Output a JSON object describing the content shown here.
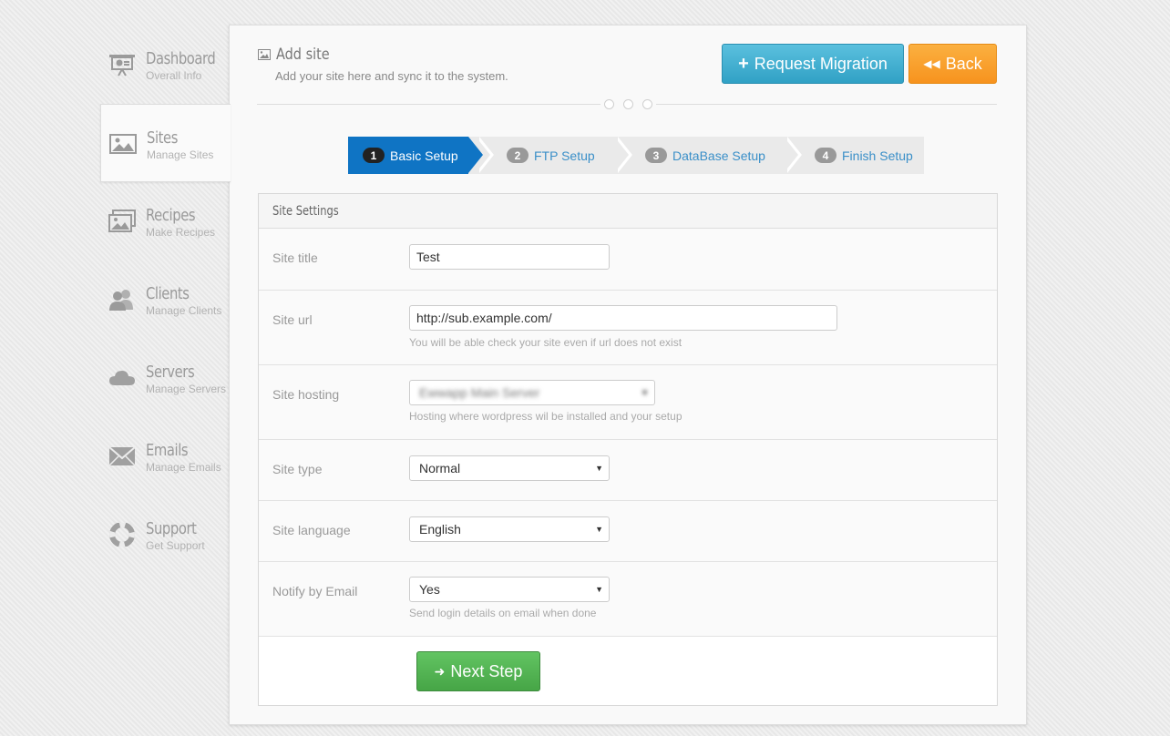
{
  "sidebar": {
    "items": [
      {
        "label": "Dashboard",
        "sub": "Overall Info",
        "icon": "presentation-board-icon"
      },
      {
        "label": "Sites",
        "sub": "Manage Sites",
        "icon": "image-icon",
        "active": true
      },
      {
        "label": "Recipes",
        "sub": "Make Recipes",
        "icon": "pictures-icon"
      },
      {
        "label": "Clients",
        "sub": "Manage Clients",
        "icon": "users-icon"
      },
      {
        "label": "Servers",
        "sub": "Manage Servers",
        "icon": "cloud-icon"
      },
      {
        "label": "Emails",
        "sub": "Manage Emails",
        "icon": "envelope-icon"
      },
      {
        "label": "Support",
        "sub": "Get Support",
        "icon": "lifebuoy-icon"
      }
    ]
  },
  "header": {
    "title": "Add site",
    "subtitle": "Add your site here and sync it to the system.",
    "migrate_label": "Request Migration",
    "back_label": "Back"
  },
  "wizard": {
    "steps": [
      {
        "num": "1",
        "label": "Basic Setup",
        "active": true
      },
      {
        "num": "2",
        "label": "FTP Setup"
      },
      {
        "num": "3",
        "label": "DataBase Setup"
      },
      {
        "num": "4",
        "label": "Finish Setup"
      }
    ]
  },
  "form": {
    "section_title": "Site Settings",
    "title_label": "Site title",
    "title_value": "Test",
    "url_label": "Site url",
    "url_value": "http://sub.example.com/",
    "url_help": "You will be able check your site even if url does not exist",
    "hosting_label": "Site hosting",
    "hosting_value": "Ewwapp Main Server",
    "hosting_help": "Hosting where wordpress wil be installed and your setup",
    "type_label": "Site type",
    "type_value": "Normal",
    "language_label": "Site language",
    "language_value": "English",
    "notify_label": "Notify by Email",
    "notify_value": "Yes",
    "notify_help": "Send login details on email when done",
    "next_label": "Next Step"
  },
  "colors": {
    "accent": "#0f74c4",
    "migrate": "#3fb0d5",
    "back": "#f7931e",
    "next": "#51b351"
  }
}
